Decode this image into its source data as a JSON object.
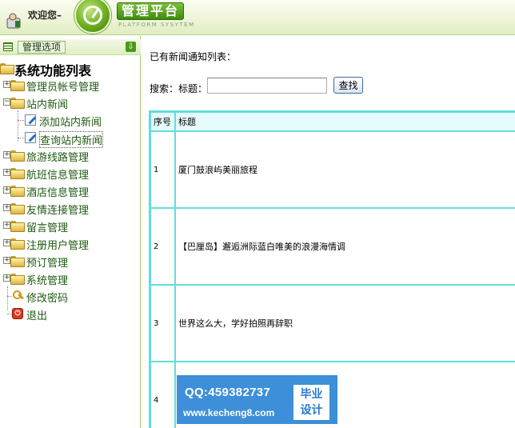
{
  "header": {
    "welcome": "欢迎您–",
    "brand_title": "管理平台",
    "brand_subtitle": "PLATFORM SYSYTEM"
  },
  "sidebar": {
    "manage_button": "管理选项",
    "collapse_arrow": "⇩",
    "tree_title": "系统功能列表",
    "items": [
      {
        "label": "管理员帐号管理",
        "icon": "folder-icon",
        "expanded": false
      },
      {
        "label": "站内新闻",
        "icon": "folder-icon",
        "expanded": true
      },
      {
        "label": "添加站内新闻",
        "icon": "edit-icon"
      },
      {
        "label": "查询站内新闻",
        "icon": "edit-icon"
      },
      {
        "label": "旅游线路管理",
        "icon": "folder-icon",
        "expanded": false
      },
      {
        "label": "航班信息管理",
        "icon": "folder-icon",
        "expanded": false
      },
      {
        "label": "酒店信息管理",
        "icon": "folder-icon",
        "expanded": false
      },
      {
        "label": "友情连接管理",
        "icon": "folder-icon",
        "expanded": false
      },
      {
        "label": "留言管理",
        "icon": "folder-icon",
        "expanded": false
      },
      {
        "label": "注册用户管理",
        "icon": "folder-icon",
        "expanded": false
      },
      {
        "label": "预订管理",
        "icon": "folder-icon",
        "expanded": false
      },
      {
        "label": "系统管理",
        "icon": "folder-icon",
        "expanded": false
      },
      {
        "label": "修改密码",
        "icon": "key-icon"
      },
      {
        "label": "退出",
        "icon": "exit-icon"
      }
    ]
  },
  "main": {
    "heading": "已有新闻通知列表：",
    "search": {
      "label": "搜索：标题：",
      "value": "",
      "button": "查找"
    },
    "table": {
      "columns": [
        "序号",
        "标题"
      ],
      "rows": [
        {
          "index": "1",
          "title": "厦门鼓浪屿美丽旅程"
        },
        {
          "index": "2",
          "title": "【巴厘岛】邂逅洲际蓝白唯美的浪漫海情调"
        },
        {
          "index": "3",
          "title": "世界这么大，学好拍照再辞职"
        },
        {
          "index": "4",
          "title": ""
        }
      ]
    }
  },
  "watermark": {
    "qq": "QQ:459382737",
    "site": "www.kecheng8.com",
    "stamp_line1": "毕业",
    "stamp_line2": "设计"
  },
  "colors": {
    "header_green": "#dfeec0",
    "brand_green": "#3f8b10",
    "tree_text": "#1e5a10",
    "table_border": "#5fe0dc",
    "watermark_blue": "#3c8fd8"
  }
}
